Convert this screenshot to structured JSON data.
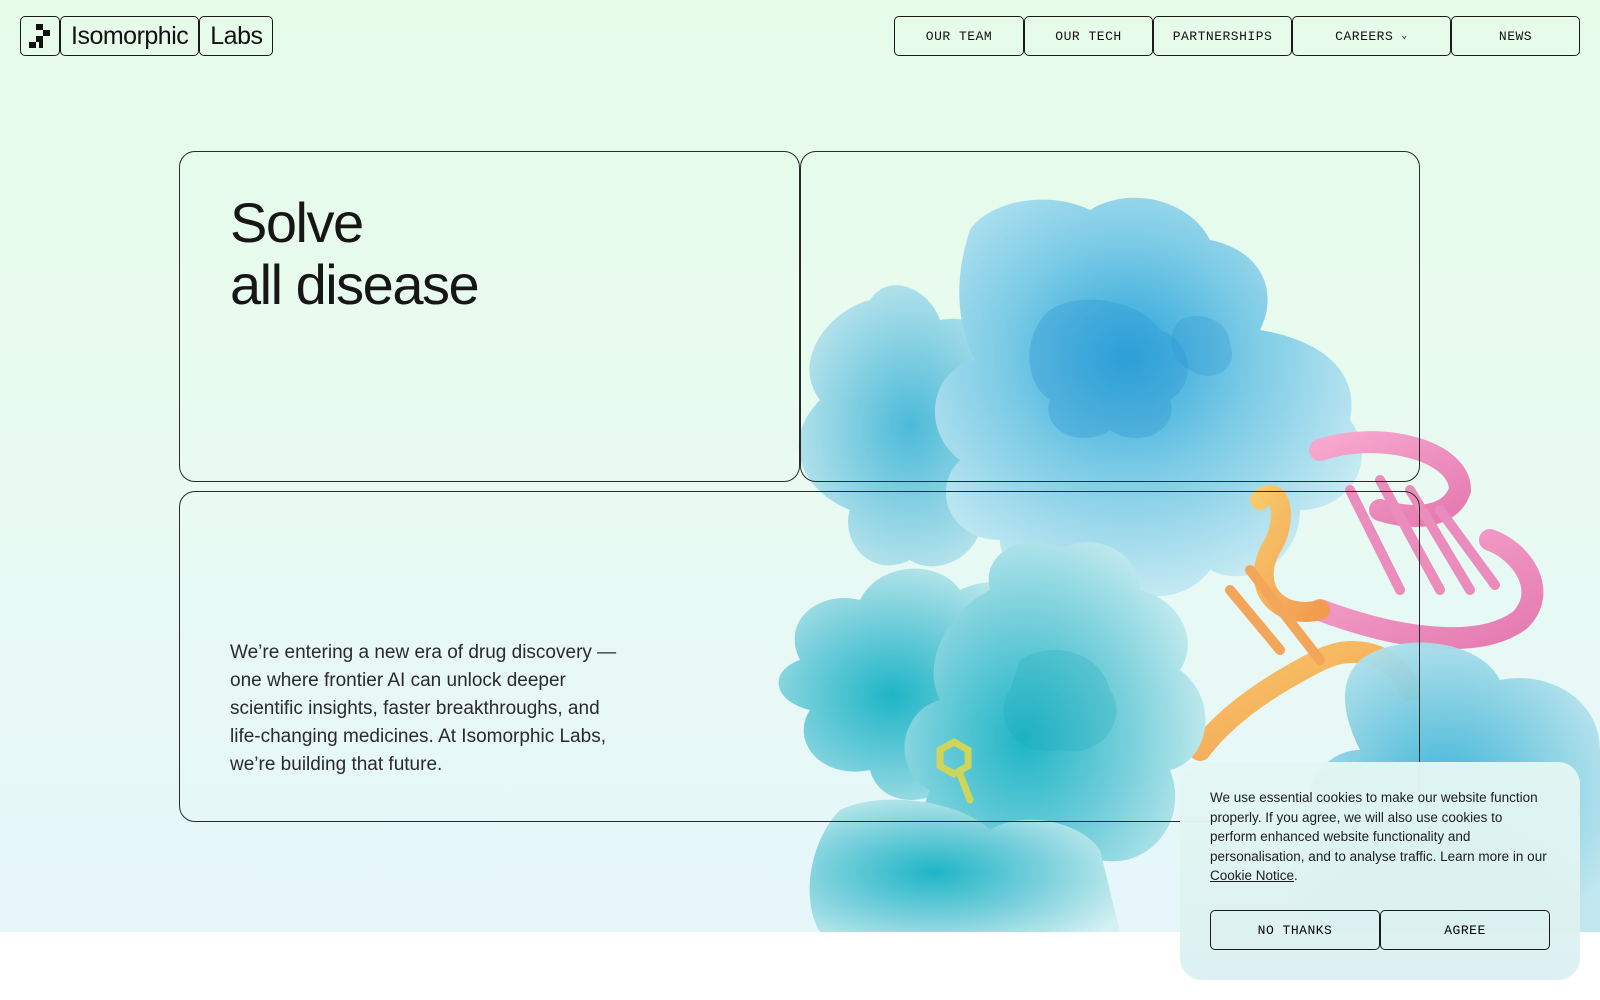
{
  "brand": {
    "word1": "Isomorphic",
    "word2": "Labs",
    "logo_icon": "pixel-grid-logo"
  },
  "nav": {
    "items": [
      {
        "label": "OUR TEAM"
      },
      {
        "label": "OUR TECH"
      },
      {
        "label": "PARTNERSHIPS"
      },
      {
        "label": "CAREERS",
        "icon": "chevron-down-icon"
      },
      {
        "label": "NEWS"
      }
    ]
  },
  "hero": {
    "headline_line1": "Solve",
    "headline_line2": "all disease",
    "intro": "We’re entering a new era of drug discovery — one where frontier AI can unlock deeper scientific insights, faster breakthroughs, and life-changing medicines. At Isomorphic Labs, we’re building that future."
  },
  "cookie": {
    "text_before": "We use essential cookies to make our website function properly. If you agree, we will also use cookies to perform enhanced website functionality and personalisation, and to analyse traffic. Learn more in our ",
    "link": "Cookie Notice",
    "text_after": ".",
    "decline_label": "NO THANKS",
    "accept_label": "AGREE"
  },
  "colors": {
    "bg_top": "#e6fbe8",
    "bg_bottom": "#e6f6fb",
    "protein_blue": "#5ab8dc",
    "dna_pink": "#ec88b8",
    "dna_orange": "#f5b560"
  }
}
